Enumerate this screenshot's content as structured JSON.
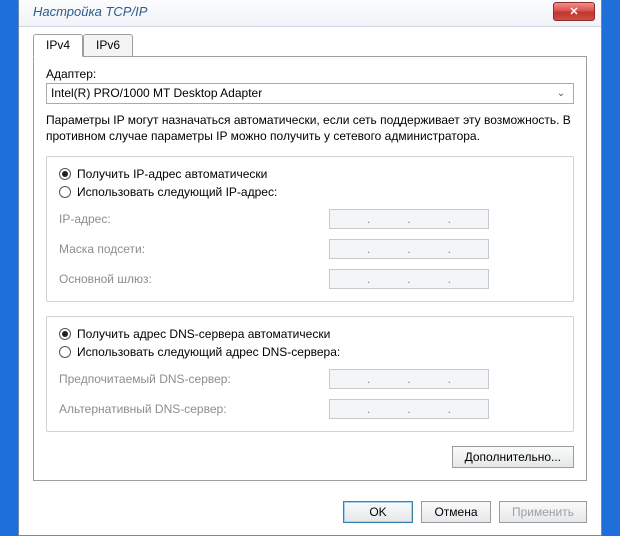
{
  "window": {
    "title": "Настройка TCP/IP"
  },
  "tabs": {
    "ipv4": "IPv4",
    "ipv6": "IPv6"
  },
  "adapter": {
    "label": "Адаптер:",
    "value": "Intel(R) PRO/1000 MT Desktop Adapter"
  },
  "info": "Параметры IP могут назначаться автоматически, если сеть поддерживает эту возможность. В противном случае параметры IP можно получить у сетевого администратора.",
  "ip_section": {
    "auto": "Получить IP-адрес автоматически",
    "manual": "Использовать следующий IP-адрес:",
    "ip_label": "IP-адрес:",
    "mask_label": "Маска подсети:",
    "gw_label": "Основной шлюз:"
  },
  "dns_section": {
    "auto": "Получить адрес DNS-сервера автоматически",
    "manual": "Использовать следующий адрес DNS-сервера:",
    "pref_label": "Предпочитаемый DNS-сервер:",
    "alt_label": "Альтернативный DNS-сервер:"
  },
  "buttons": {
    "advanced": "Дополнительно...",
    "ok": "OK",
    "cancel": "Отмена",
    "apply": "Применить"
  }
}
